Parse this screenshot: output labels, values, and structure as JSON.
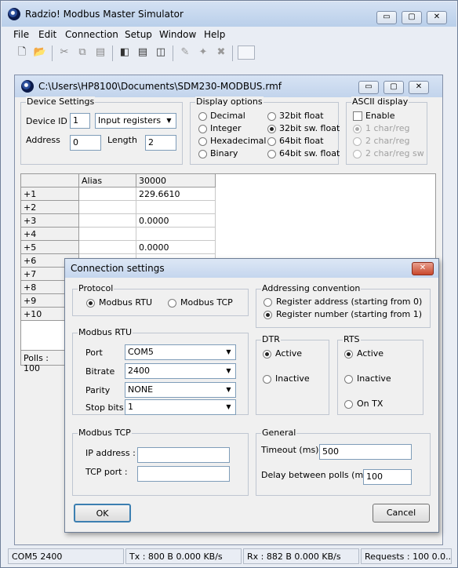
{
  "app": {
    "title": "Radzio! Modbus Master Simulator",
    "caption_minimize": "▭",
    "caption_maximize": "▢",
    "caption_close": "✕"
  },
  "menu": [
    "File",
    "Edit",
    "Connection",
    "Setup",
    "Window",
    "Help"
  ],
  "toolbar": [
    "new-file-icon",
    "open-folder-icon",
    "cut-icon",
    "copy-icon",
    "paste-icon",
    "cascade-windows-icon",
    "tile-horizontal-icon",
    "tile-vertical-icon",
    "pencil-icon",
    "connect-icon",
    "disconnect-icon",
    "blank-icon"
  ],
  "child": {
    "title": "C:\\Users\\HP8100\\Documents\\SDM230-MODBUS.rmf",
    "device_settings": {
      "label": "Device Settings",
      "device_id_label": "Device ID",
      "device_id": "1",
      "register_type": "Input registers",
      "address_label": "Address",
      "address": "0",
      "length_label": "Length",
      "length": "2"
    },
    "display_options": {
      "label": "Display options",
      "options": [
        "Decimal",
        "Integer",
        "Hexadecimal",
        "Binary",
        "32bit float",
        "32bit sw. float",
        "64bit float",
        "64bit sw. float"
      ],
      "selected": "32bit sw. float"
    },
    "ascii_display": {
      "label": "ASCII display",
      "enable_label": "Enable",
      "options": [
        "1 char/reg",
        "2 char/reg",
        "2 char/reg sw"
      ],
      "selected": "1 char/reg"
    },
    "grid": {
      "columns": [
        "",
        "Alias",
        "30000"
      ],
      "rows": [
        {
          "label": "+1",
          "alias": "",
          "value": "229.6610"
        },
        {
          "label": "+2",
          "alias": "",
          "value": ""
        },
        {
          "label": "+3",
          "alias": "",
          "value": "0.0000"
        },
        {
          "label": "+4",
          "alias": "",
          "value": ""
        },
        {
          "label": "+5",
          "alias": "",
          "value": "0.0000"
        },
        {
          "label": "+6",
          "alias": "",
          "value": ""
        },
        {
          "label": "+7",
          "alias": "",
          "value": ""
        },
        {
          "label": "+8",
          "alias": "",
          "value": ""
        },
        {
          "label": "+9",
          "alias": "",
          "value": ""
        },
        {
          "label": "+10",
          "alias": "",
          "value": ""
        }
      ]
    },
    "polls": "Polls : 100"
  },
  "dialog": {
    "title": "Connection settings",
    "close": "✕",
    "protocol": {
      "label": "Protocol",
      "rtu": "Modbus RTU",
      "tcp": "Modbus TCP",
      "selected": "Modbus RTU"
    },
    "addressing": {
      "label": "Addressing convention",
      "address": "Register address (starting from 0)",
      "number": "Register number (starting from 1)",
      "selected": "number"
    },
    "rtu": {
      "label": "Modbus RTU",
      "port_label": "Port",
      "port": "COM5",
      "bitrate_label": "Bitrate",
      "bitrate": "2400",
      "parity_label": "Parity",
      "parity": "NONE",
      "stopbits_label": "Stop bits",
      "stopbits": "1"
    },
    "dtr": {
      "label": "DTR",
      "active": "Active",
      "inactive": "Inactive",
      "selected": "Active"
    },
    "rts": {
      "label": "RTS",
      "active": "Active",
      "inactive": "Inactive",
      "ontx": "On TX",
      "selected": "Active"
    },
    "tcp": {
      "label": "Modbus TCP",
      "ip_label": "IP address :",
      "ip": "",
      "port_label": "TCP port :",
      "port": ""
    },
    "general": {
      "label": "General",
      "timeout_label": "Timeout (ms)",
      "timeout": "500",
      "delay_label": "Delay between polls (ms)",
      "delay": "100"
    },
    "ok": "OK",
    "cancel": "Cancel"
  },
  "status": {
    "port": "COM5 2400",
    "tx": "Tx : 800 B   0.000 KB/s",
    "rx": "Rx : 882 B   0.000 KB/s",
    "requests": "Requests : 100   0.0..."
  }
}
